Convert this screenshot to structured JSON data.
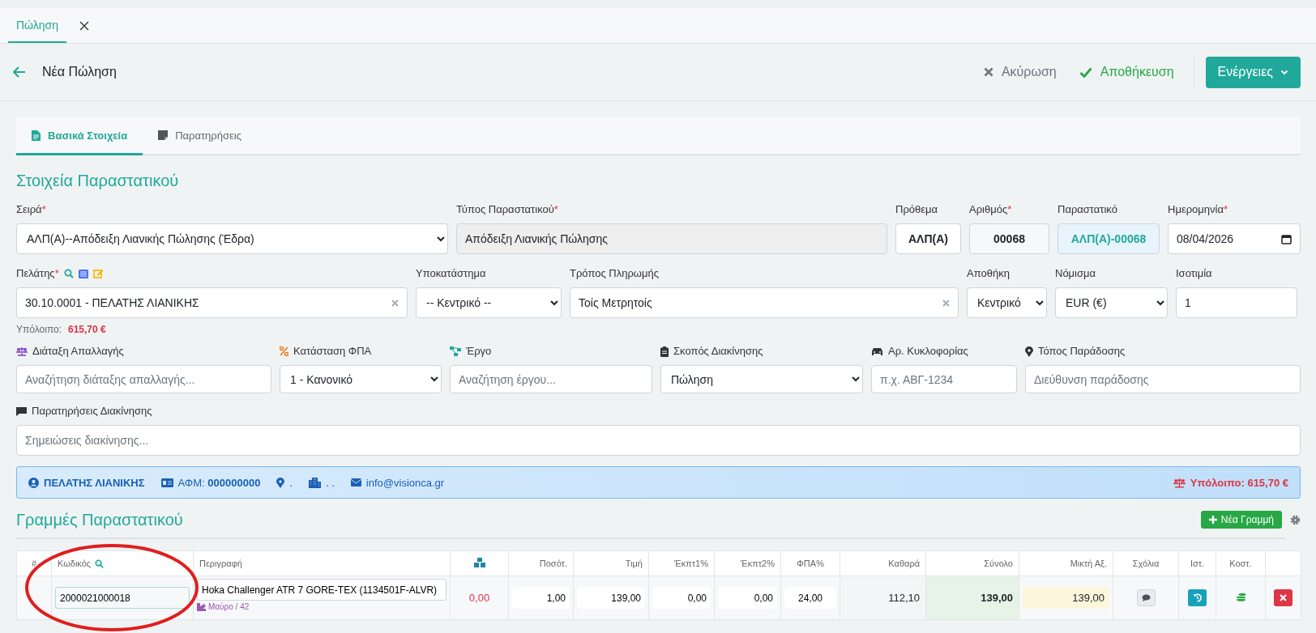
{
  "window_tabs": [
    {
      "label": "Πώληση",
      "selected": true
    }
  ],
  "header": {
    "title": "Νέα Πώληση",
    "cancel": "Ακύρωση",
    "save": "Αποθήκευση",
    "actions": "Ενέργειες"
  },
  "content_tabs": [
    {
      "label": "Βασικά Στοιχεία",
      "selected": true
    },
    {
      "label": "Παρατηρήσεις",
      "selected": false
    }
  ],
  "section_title": "Στοιχεία Παραστατικού",
  "row_1": [
    {
      "label": "Σειρά",
      "marker": "*",
      "kind": "select",
      "value": "ΑΛΠ(Α)--Απόδειξη Λιανικής Πώλησης (Έδρα)"
    },
    {
      "label": "Τύπος Παραστατικού",
      "marker": "*",
      "kind": "readonly",
      "value": "Απόδειξη Λιανικής Πώλησης"
    },
    {
      "label": "Πρόθεμα",
      "kind": "bold",
      "value": "ΑΛΠ(Α)"
    },
    {
      "label": "Αριθμός",
      "marker": "*",
      "kind": "number",
      "value": "00068"
    },
    {
      "label": "Παραστατικό",
      "kind": "document",
      "value": "ΑΛΠ(Α)-00068"
    },
    {
      "label": "Ημερομηνία",
      "marker": "*",
      "kind": "date",
      "value": "08/04/2026"
    }
  ],
  "row_2": [
    {
      "label": "Πελάτης",
      "marker": "*",
      "kind": "combo",
      "value": "30.10.0001 - ΠΕΛΑΤΗΣ ΛΙΑΝΙΚΗΣ"
    },
    {
      "label": "Υποκατάστημα",
      "kind": "select",
      "value": "-- Κεντρικό --"
    },
    {
      "label": "Τρόπος Πληρωμής",
      "kind": "combo",
      "value": "Τοίς Μετρητοίς"
    },
    {
      "label": "Αποθήκη",
      "kind": "select",
      "value": "Κεντρικό"
    },
    {
      "label": "Νόμισμα",
      "kind": "select",
      "value": "EUR (€)"
    },
    {
      "label": "Ισοτιμία",
      "kind": "input",
      "value": "1"
    }
  ],
  "balance": {
    "label": "Υπόλοιπο:",
    "value": "615,70 €"
  },
  "row_3": [
    {
      "label": "Διάταξη Απαλλαγής",
      "kind": "input",
      "placeholder": "Αναζήτηση διάταξης απαλλαγής..."
    },
    {
      "label": "Κατάσταση ΦΠΑ",
      "kind": "select",
      "value": "1 - Κανονικό"
    },
    {
      "label": "Έργο",
      "kind": "input",
      "placeholder": "Αναζήτηση έργου..."
    },
    {
      "label": "Σκοπός Διακίνησης",
      "kind": "select",
      "value": "Πώληση"
    },
    {
      "label": "Αρ. Κυκλοφορίας",
      "kind": "input",
      "placeholder": "π.χ. ΑΒΓ-1234"
    },
    {
      "label": "Τόπος Παράδοσης",
      "kind": "input",
      "placeholder": "Διεύθυνση παράδοσης"
    }
  ],
  "remarks": {
    "label": "Παρατηρήσεις Διακίνησης",
    "placeholder": "Σημειώσεις διακίνησης..."
  },
  "info_bar": {
    "name": "ΠΕΛΑΤΗΣ ΛΙΑΝΙΚΗΣ",
    "afm_label": "ΑΦΜ:",
    "afm": "000000000",
    "location": ".",
    "building": ". .",
    "email": "info@visionca.gr",
    "balance": "Υπόλοιπο: 615,70 €"
  },
  "lines_title": "Γραμμές Παραστατικού",
  "new_line_button": "Νέα Γραμμή",
  "table": {
    "columns": [
      {
        "label": "#",
        "kind": "text"
      },
      {
        "label": "Κωδικός",
        "kind": "search"
      },
      {
        "label": "Περιγραφή",
        "kind": "text"
      },
      {
        "kind": "stock"
      },
      {
        "label": "Ποσότ.",
        "kind": "text"
      },
      {
        "label": "Τιμή",
        "kind": "text"
      },
      {
        "label": "Έκπτ1%",
        "kind": "text"
      },
      {
        "label": "Έκπτ2%",
        "kind": "text"
      },
      {
        "label": "ΦΠΑ%",
        "kind": "text"
      },
      {
        "label": "Καθαρά",
        "kind": "text"
      },
      {
        "label": "Σύνολο",
        "kind": "text"
      },
      {
        "label": "Μικτή Αξ.",
        "kind": "text"
      },
      {
        "label": "Σχόλια",
        "kind": "text"
      },
      {
        "label": "Ιστ.",
        "kind": "text"
      },
      {
        "label": "Κοστ.",
        "kind": "text"
      },
      {
        "kind": "blank"
      }
    ],
    "rows": [
      {
        "code": "2000021000018",
        "description": "Hoka Challenger ATR 7 GORE-TEX (1134501F-ALVR)",
        "variant": "Μαύρο / 42",
        "stock": "0,00",
        "quantity": "1,00",
        "price": "139,00",
        "discount_1": "0,00",
        "discount_2": "0,00",
        "vat": "24,00",
        "net": "112,10",
        "total": "139,00",
        "gross": "139,00"
      }
    ]
  },
  "highlight_ring": true
}
